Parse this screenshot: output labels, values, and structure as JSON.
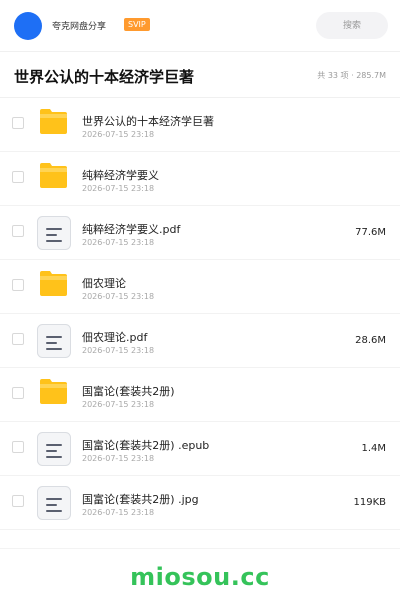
{
  "header": {
    "brand_name": "夸克网盘分享",
    "badge": "SVIP",
    "search_placeholder": "搜索"
  },
  "folder": {
    "title": "世界公认的十本经济学巨著",
    "summary": "共 33 项 · 285.7M"
  },
  "files": [
    {
      "name": "世界公认的十本经济学巨著",
      "date": "2026-07-15 23:18",
      "size": "",
      "type": "folder"
    },
    {
      "name": "纯粹经济学要义",
      "date": "2026-07-15 23:18",
      "size": "",
      "type": "folder"
    },
    {
      "name": "纯粹经济学要义.pdf",
      "date": "2026-07-15 23:18",
      "size": "77.6M",
      "type": "file"
    },
    {
      "name": "佃农理论",
      "date": "2026-07-15 23:18",
      "size": "",
      "type": "folder"
    },
    {
      "name": "佃农理论.pdf",
      "date": "2026-07-15 23:18",
      "size": "28.6M",
      "type": "file"
    },
    {
      "name": "国富论(套装共2册)",
      "date": "2026-07-15 23:18",
      "size": "",
      "type": "folder"
    },
    {
      "name": "国富论(套装共2册) .epub",
      "date": "2026-07-15 23:18",
      "size": "1.4M",
      "type": "file"
    },
    {
      "name": "国富论(套装共2册) .jpg",
      "date": "2026-07-15 23:18",
      "size": "119KB",
      "type": "file"
    }
  ],
  "watermark": "miosou.cc",
  "colors": {
    "avatar": "#1e6ff5",
    "badge": "#ff9a2e",
    "folder": "#ffc21a",
    "watermark": "#35c35a"
  }
}
